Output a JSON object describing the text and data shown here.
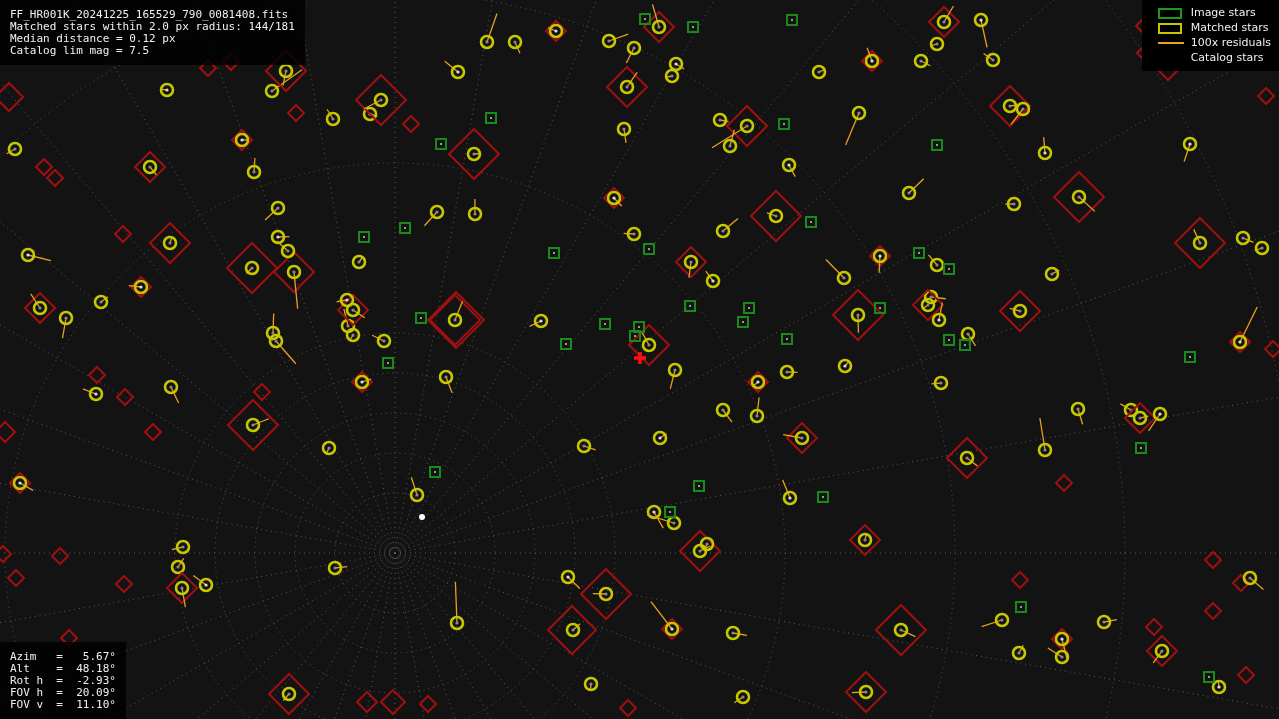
{
  "file_info": {
    "lines": [
      "FF_HR001K_20241225_165529_790_0081408.fits",
      "Matched stars within 2.0 px radius: 144/181",
      "Median distance = 0.12 px",
      "Catalog lim mag = 7.5"
    ]
  },
  "legend": [
    {
      "kind": "image",
      "label": "Image stars"
    },
    {
      "kind": "matched",
      "label": "Matched stars"
    },
    {
      "kind": "residual",
      "label": "100x residuals"
    },
    {
      "kind": "catalog",
      "label": "Catalog stars"
    }
  ],
  "pointing": {
    "lines": [
      "Azim   =   5.67°",
      "Alt    =  48.18°",
      "Rot h  =  -2.93°",
      "FOV h  =  20.09°",
      "FOV v  =  11.10°"
    ]
  }
}
